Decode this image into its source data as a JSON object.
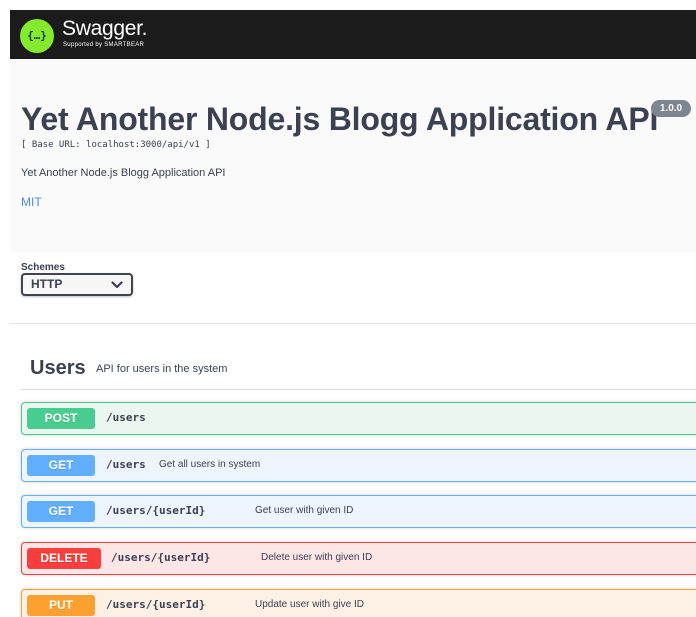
{
  "topbar": {
    "logo_glyph": "{…}",
    "brand": "Swagger.",
    "brand_sub": "Supported by SMARTBEAR"
  },
  "info": {
    "title": "Yet Another Node.js Blogg Application API",
    "version": "1.0.0",
    "base_url": "[ Base URL: localhost:3000/api/v1 ]",
    "description": "Yet Another Node.js Blogg Application API",
    "license": "MIT"
  },
  "schemes": {
    "label": "Schemes",
    "selected": "HTTP"
  },
  "tag": {
    "name": "Users",
    "description": "API for users in the system"
  },
  "operations": [
    {
      "method": "POST",
      "path": "/users",
      "summary": ""
    },
    {
      "method": "GET",
      "path": "/users",
      "summary": "Get all users in system"
    },
    {
      "method": "GET",
      "path": "/users/{userId}",
      "summary": "Get user with given ID"
    },
    {
      "method": "DELETE",
      "path": "/users/{userId}",
      "summary": "Delete user with given ID"
    },
    {
      "method": "PUT",
      "path": "/users/{userId}",
      "summary": "Update user with give ID"
    }
  ],
  "colors": {
    "post": "#49cc90",
    "get": "#61affe",
    "delete": "#f93e3e",
    "put": "#fca130",
    "topbar": "#1b1b1b",
    "logo": "#85ea2d",
    "link": "#4990e2"
  },
  "icons": {
    "logo": "swagger-logo-icon",
    "select": "chevron-down-icon"
  }
}
